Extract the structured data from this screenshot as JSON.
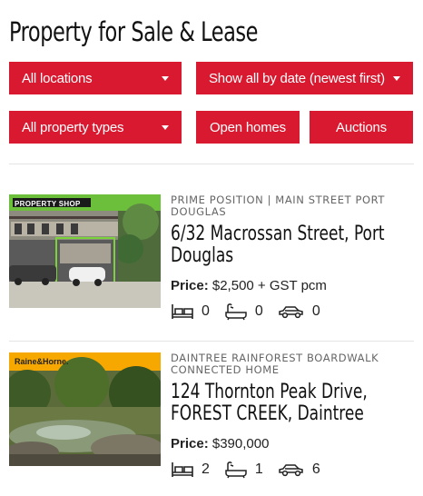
{
  "title": "Property for Sale & Lease",
  "filters": {
    "location": "All locations",
    "sort": "Show all by date (newest first)",
    "property_type": "All property types",
    "open_homes": "Open homes",
    "auctions": "Auctions"
  },
  "colors": {
    "accent": "#d8192f"
  },
  "listings": [
    {
      "agency_logo": "PROPERTY SHOP",
      "agency_color": "#6cbf3a",
      "tagline": "PRIME POSITION | MAIN STREET PORT DOUGLAS",
      "address": "6/32 Macrossan Street, Port Douglas",
      "price_label": "Price:",
      "price": "$2,500 + GST pcm",
      "beds": "0",
      "baths": "0",
      "cars": "0"
    },
    {
      "agency_logo": "Raine&Horne.",
      "agency_color": "#f6a800",
      "tagline": "DAINTREE RAINFOREST BOARDWALK CONNECTED HOME",
      "address": "124 Thornton Peak Drive, FOREST CREEK, Daintree",
      "price_label": "Price:",
      "price": "$390,000",
      "beds": "2",
      "baths": "1",
      "cars": "6"
    }
  ]
}
